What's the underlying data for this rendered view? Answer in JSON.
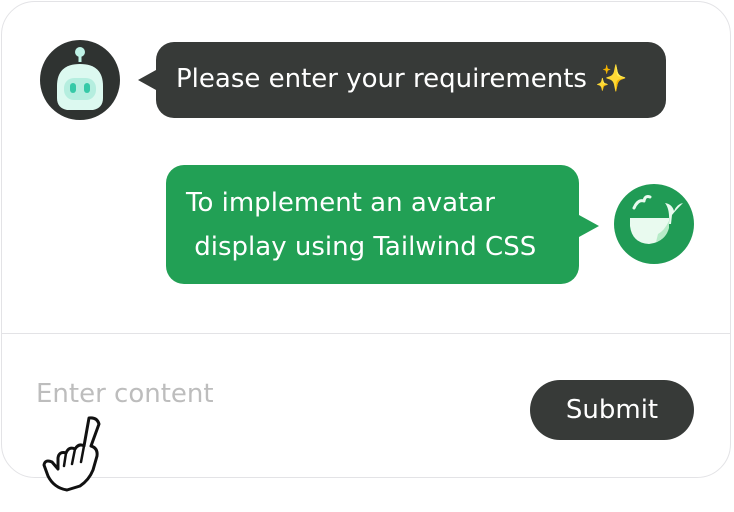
{
  "chat": {
    "messages": [
      {
        "role": "assistant",
        "avatar_icon": "robot-avatar-icon",
        "text": "Please enter your requirements ✨"
      },
      {
        "role": "user",
        "avatar_icon": "whale-avatar-icon",
        "text": "To implement an avatar\n display using Tailwind CSS"
      }
    ]
  },
  "composer": {
    "placeholder": "Enter content",
    "value": "",
    "submit_label": "Submit"
  },
  "cursor": {
    "icon": "hand-pointer-icon"
  },
  "colors": {
    "assistant_bubble": "#373a38",
    "user_bubble": "#22a055",
    "user_avatar_bg": "#209b55",
    "submit_button": "#373a38",
    "card_border": "#e3e3e6",
    "placeholder": "#bdbdbd"
  }
}
